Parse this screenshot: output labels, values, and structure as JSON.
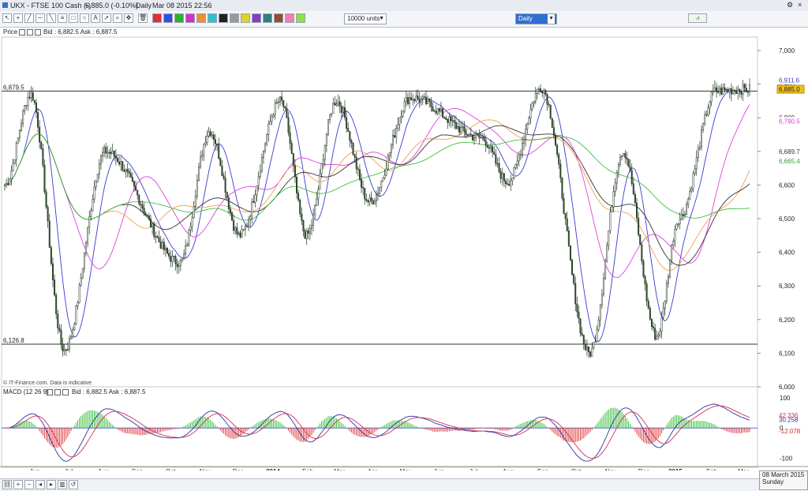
{
  "window": {
    "title": "UKX - FTSE 100 Cash (-)",
    "quote": "6,885.0 (-0.10%)",
    "period": "Daily",
    "datetime": "Mar 08 2015 22:56"
  },
  "toolbar": {
    "units_value": "10000 units",
    "timeframe_value": "Daily"
  },
  "price_panel": {
    "label": "Price",
    "bid_ask": "Bid : 6,882.5 Ask : 6,887.5",
    "watermark": "© IT-Finance.com. Data is indicative",
    "level_upper": "6,879.5",
    "level_lower": "6,126.8",
    "y_ticks": [
      "7,000",
      "6,900",
      "6,800",
      "6,700",
      "6,600",
      "6,500",
      "6,400",
      "6,300",
      "6,200",
      "6,100",
      "6,000"
    ],
    "right_labels": {
      "ma_blue": "6,911.6",
      "last": "6,885.0",
      "ma_pink": "6,790.5",
      "ma_black": "6,689.7",
      "ma_green": "6,665.4"
    }
  },
  "macd_panel": {
    "label": "MACD (12 26 9)",
    "bid_ask": "Bid : 6,882.5 Ask : 6,887.5",
    "y_ticks": [
      "100",
      "0",
      "-100"
    ],
    "right_labels": {
      "signal": "42.336",
      "macd": "30.258",
      "hist": "-12.078"
    }
  },
  "x_axis": {
    "labels": [
      "Jun",
      "Jul",
      "Aug",
      "Sep",
      "Oct",
      "Nov",
      "Dec",
      "2014",
      "Feb",
      "Mar",
      "Apr",
      "May",
      "Jun",
      "Jul",
      "Aug",
      "Sep",
      "Oct",
      "Nov",
      "Dec",
      "2015",
      "Feb",
      "Mar"
    ]
  },
  "date_box": {
    "date": "08 March 2015",
    "weekday": "Sunday"
  },
  "colors": {
    "candle_up": "#ffffff",
    "candle_down": "#2f4f2f",
    "ma_blue": "#3a3ad0",
    "ma_pink": "#e040e0",
    "ma_black": "#333333",
    "ma_orange": "#f0a050",
    "ma_green": "#40c040",
    "hist_up": "#40c040",
    "hist_down": "#e04040"
  },
  "chart_data": {
    "type": "candlestick",
    "y_range": [
      6000,
      7040
    ],
    "key_points": [
      {
        "x": "Jun 2013",
        "close": 6600
      },
      {
        "x": "late May 2013",
        "close": 6870
      },
      {
        "x": "late Jun 2013",
        "close": 6110
      },
      {
        "x": "early Aug 2013",
        "close": 6700
      },
      {
        "x": "Oct 2013",
        "close": 6370
      },
      {
        "x": "Nov 2013",
        "close": 6760
      },
      {
        "x": "Dec 2013",
        "close": 6450
      },
      {
        "x": "Jan 2014",
        "close": 6850
      },
      {
        "x": "Feb 2014",
        "close": 6450
      },
      {
        "x": "Mar 2014",
        "close": 6850
      },
      {
        "x": "Apr 2014",
        "close": 6550
      },
      {
        "x": "May 2014",
        "close": 6860
      },
      {
        "x": "Jul 2014",
        "close": 6740
      },
      {
        "x": "Aug 2014",
        "close": 6610
      },
      {
        "x": "Sep 2014",
        "close": 6890
      },
      {
        "x": "Oct 2014",
        "close": 6100
      },
      {
        "x": "Nov 2014",
        "close": 6700
      },
      {
        "x": "Dec 2014",
        "close": 6150
      },
      {
        "x": "Jan 2015",
        "close": 6500
      },
      {
        "x": "Feb 2015",
        "close": 6880
      },
      {
        "x": "Mar 2015",
        "close": 6885
      }
    ],
    "horizontal_levels": [
      6879.5,
      6126.8
    ],
    "macd": {
      "y_range": [
        -130,
        110
      ],
      "last_signal": 42.336,
      "last_macd": 30.258,
      "last_hist": -12.078
    }
  }
}
